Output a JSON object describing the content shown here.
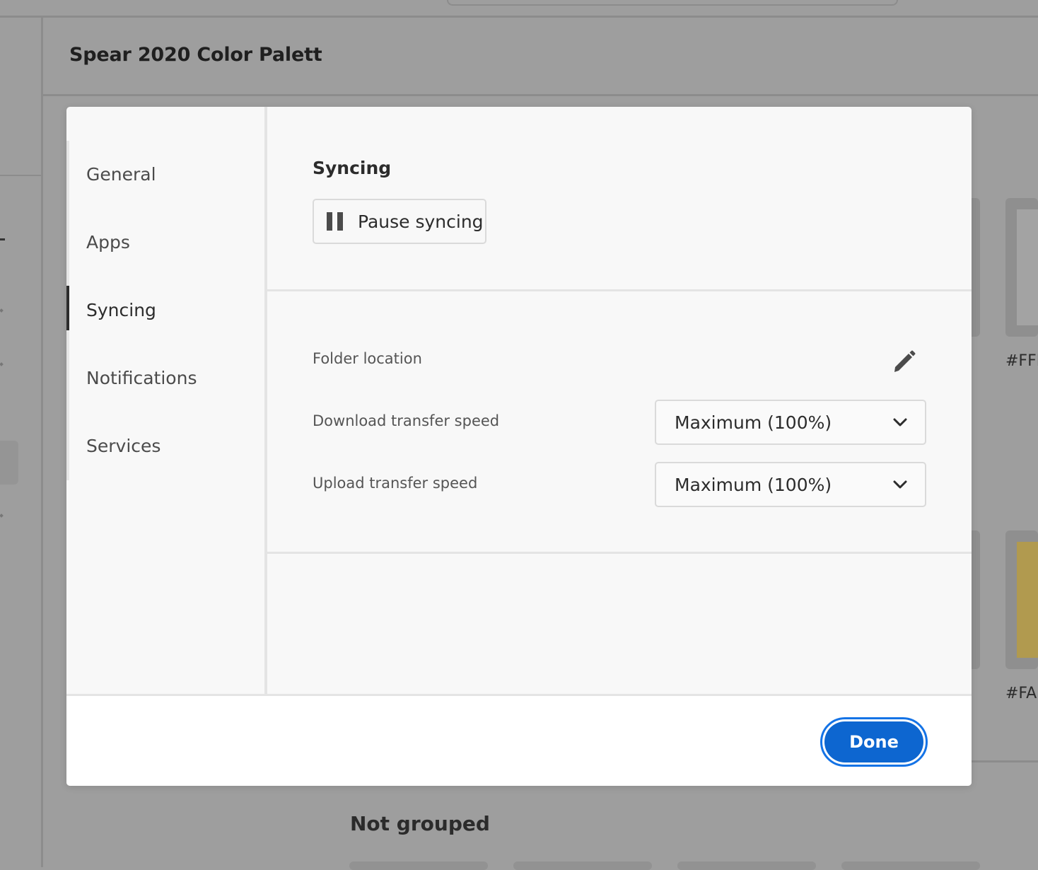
{
  "background": {
    "title": "Spear 2020 Color Palett",
    "hex_labels": [
      "#FFI",
      "#FAI"
    ],
    "section_heading": "Not grouped",
    "swatch_color": "#b19a4f"
  },
  "dialog": {
    "sidebar": {
      "items": [
        {
          "label": "General"
        },
        {
          "label": "Apps"
        },
        {
          "label": "Syncing",
          "selected": true
        },
        {
          "label": "Notifications"
        },
        {
          "label": "Services"
        }
      ]
    },
    "syncing": {
      "title": "Syncing",
      "pause_button": {
        "label": "Pause syncing",
        "icon": "pause-icon"
      },
      "folder_location": {
        "label": "Folder location",
        "icon": "pencil-edit-icon"
      },
      "download_speed": {
        "label": "Download transfer speed",
        "value": "Maximum (100%)"
      },
      "upload_speed": {
        "label": "Upload transfer speed",
        "value": "Maximum (100%)"
      }
    },
    "footer": {
      "done_label": "Done"
    }
  },
  "colors": {
    "accent": "#0d66d0",
    "accent_ring": "#1473e6",
    "overlay": "#9e9e9e"
  }
}
